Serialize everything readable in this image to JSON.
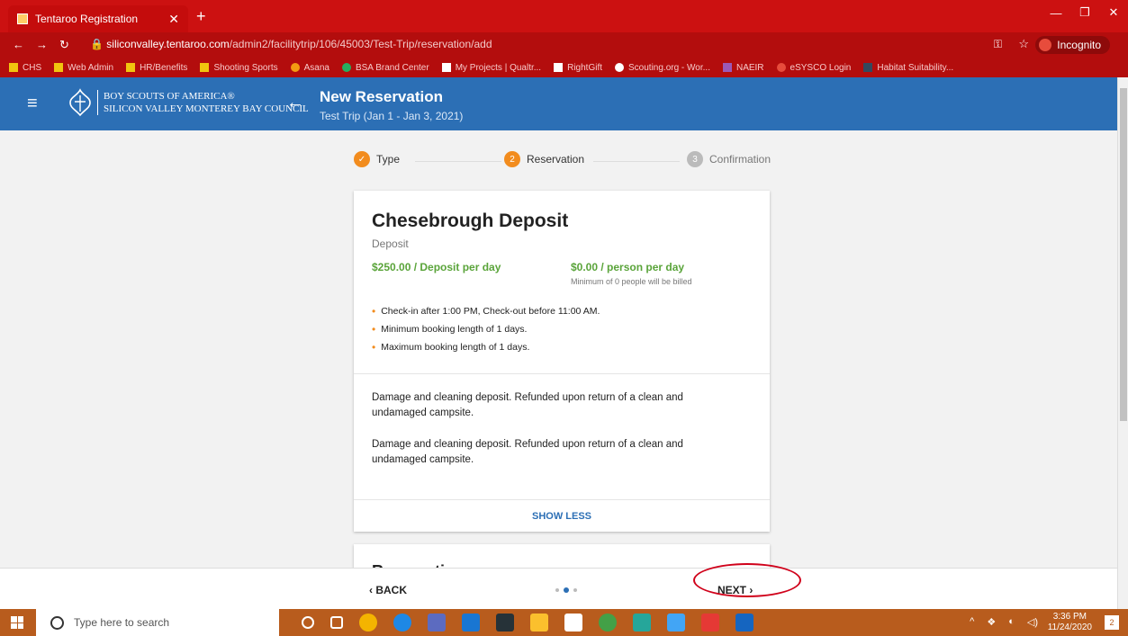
{
  "browser": {
    "tab_title": "Tentaroo Registration",
    "new_tab": "+",
    "url_host": "siliconvalley.tentaroo.com",
    "url_path": "/admin2/facilitytrip/106/45003/Test-Trip/reservation/add",
    "incognito_label": "Incognito",
    "bookmarks": [
      "CHS",
      "Web Admin",
      "HR/Benefits",
      "Shooting Sports",
      "Asana",
      "BSA Brand Center",
      "My Projects | Qualtr...",
      "RightGift",
      "Scouting.org - Wor...",
      "NAEIR",
      "eSYSCO Login",
      "Habitat Suitability..."
    ]
  },
  "header": {
    "org_line1": "BOY SCOUTS OF AMERICA®",
    "org_line2": "SILICON VALLEY MONTEREY BAY COUNCIL",
    "title": "New Reservation",
    "subtitle": "Test Trip (Jan 1 - Jan 3, 2021)"
  },
  "stepper": {
    "steps": [
      {
        "label": "Type",
        "marker": "✓",
        "state": "done"
      },
      {
        "label": "Reservation",
        "marker": "2",
        "state": "active"
      },
      {
        "label": "Confirmation",
        "marker": "3",
        "state": "pending"
      }
    ]
  },
  "card": {
    "title": "Chesebrough Deposit",
    "type": "Deposit",
    "price_deposit": "$250.00 / Deposit per day",
    "price_person": "$0.00 / person per day",
    "minimum_note": "Minimum of 0 people will be billed",
    "rules": [
      "Check-in after 1:00 PM, Check-out before 11:00 AM.",
      "Minimum booking length of 1 days.",
      "Maximum booking length of 1 days."
    ],
    "description1": "Damage and cleaning deposit. Refunded upon return of a clean and undamaged campsite.",
    "description2": "Damage and cleaning deposit. Refunded upon return of a clean and undamaged campsite.",
    "show_less": "SHOW LESS"
  },
  "next_card": {
    "title": "Reservation"
  },
  "footer": {
    "back_label": "‹  BACK",
    "next_label": "NEXT  ›"
  },
  "taskbar": {
    "search_placeholder": "Type here to search",
    "time": "3:36 PM",
    "date": "11/24/2020",
    "notifications": "2"
  },
  "colors": {
    "brand_blue": "#2c6fb5",
    "step_done": "#f28c1e",
    "step_pending": "#bbbbbb",
    "price_green": "#5aa43a",
    "annotation_red": "#d0021b"
  }
}
